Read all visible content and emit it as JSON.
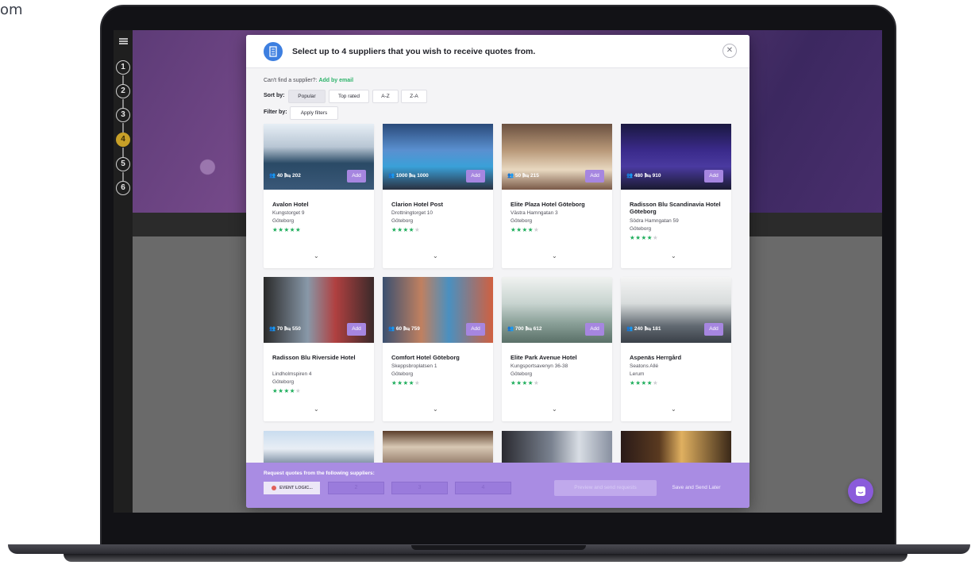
{
  "corner_text": "om",
  "sidebar": {
    "steps": [
      "1",
      "2",
      "3",
      "4",
      "5",
      "6"
    ],
    "active_step": "4"
  },
  "modal": {
    "title": "Select up to 4 suppliers that you wish to receive quotes from.",
    "close_icon": "close-icon",
    "cant_find_text": "Can't find a supplier?:",
    "add_by_email": "Add by email",
    "sort_label": "Sort by:",
    "sort_options": [
      "Popular",
      "Top rated",
      "A-Z",
      "Z-A"
    ],
    "sort_selected": "Popular",
    "filter_label": "Filter by:",
    "apply_filters": "Apply filters",
    "add_label": "Add"
  },
  "hotels": [
    {
      "name": "Avalon Hotel",
      "street": "Kungstorget 9",
      "city": "Göteborg",
      "guests": "40",
      "beds": "202",
      "stars": 5
    },
    {
      "name": "Clarion Hotel Post",
      "street": "Drottningtorget 10",
      "city": "Göteborg",
      "guests": "1000",
      "beds": "1000",
      "stars": 4
    },
    {
      "name": "Elite Plaza Hotel Göteborg",
      "street": "Västra Hamngatan 3",
      "city": "Göteborg",
      "guests": "50",
      "beds": "215",
      "stars": 4
    },
    {
      "name": "Radisson Blu Scandinavia Hotel Göteborg",
      "street": "Södra Hamngatan 59",
      "city": "Göteborg",
      "guests": "480",
      "beds": "910",
      "stars": 4
    },
    {
      "name": "Radisson Blu Riverside Hotel",
      "street": "Lindholmspiren 4",
      "city": "Göteborg",
      "guests": "70",
      "beds": "550",
      "stars": 4
    },
    {
      "name": "Comfort Hotel Göteborg",
      "street": "Skeppsbroplatsen 1",
      "city": "Göteborg",
      "guests": "60",
      "beds": "759",
      "stars": 4
    },
    {
      "name": "Elite Park Avenue Hotel",
      "street": "Kungsportsavenyn 36-38",
      "city": "Göteborg",
      "guests": "700",
      "beds": "612",
      "stars": 4
    },
    {
      "name": "Aspenäs Herrgård",
      "street": "Seatons Allé",
      "city": "Lerum",
      "guests": "240",
      "beds": "181",
      "stars": 4
    }
  ],
  "bottom_bar": {
    "request_label": "Request quotes from the following suppliers:",
    "slot_1": "EVENT LOGIC...",
    "slot_2": "2",
    "slot_3": "3",
    "slot_4": "4",
    "preview_button": "Preview and send requests",
    "save_later_button": "Save and Send Later"
  },
  "colors": {
    "accent_purple": "#a98ce3",
    "star_green": "#1fae5c",
    "link_green": "#2db36a",
    "logo_blue": "#3d7fe0",
    "active_step": "#c8a028"
  }
}
